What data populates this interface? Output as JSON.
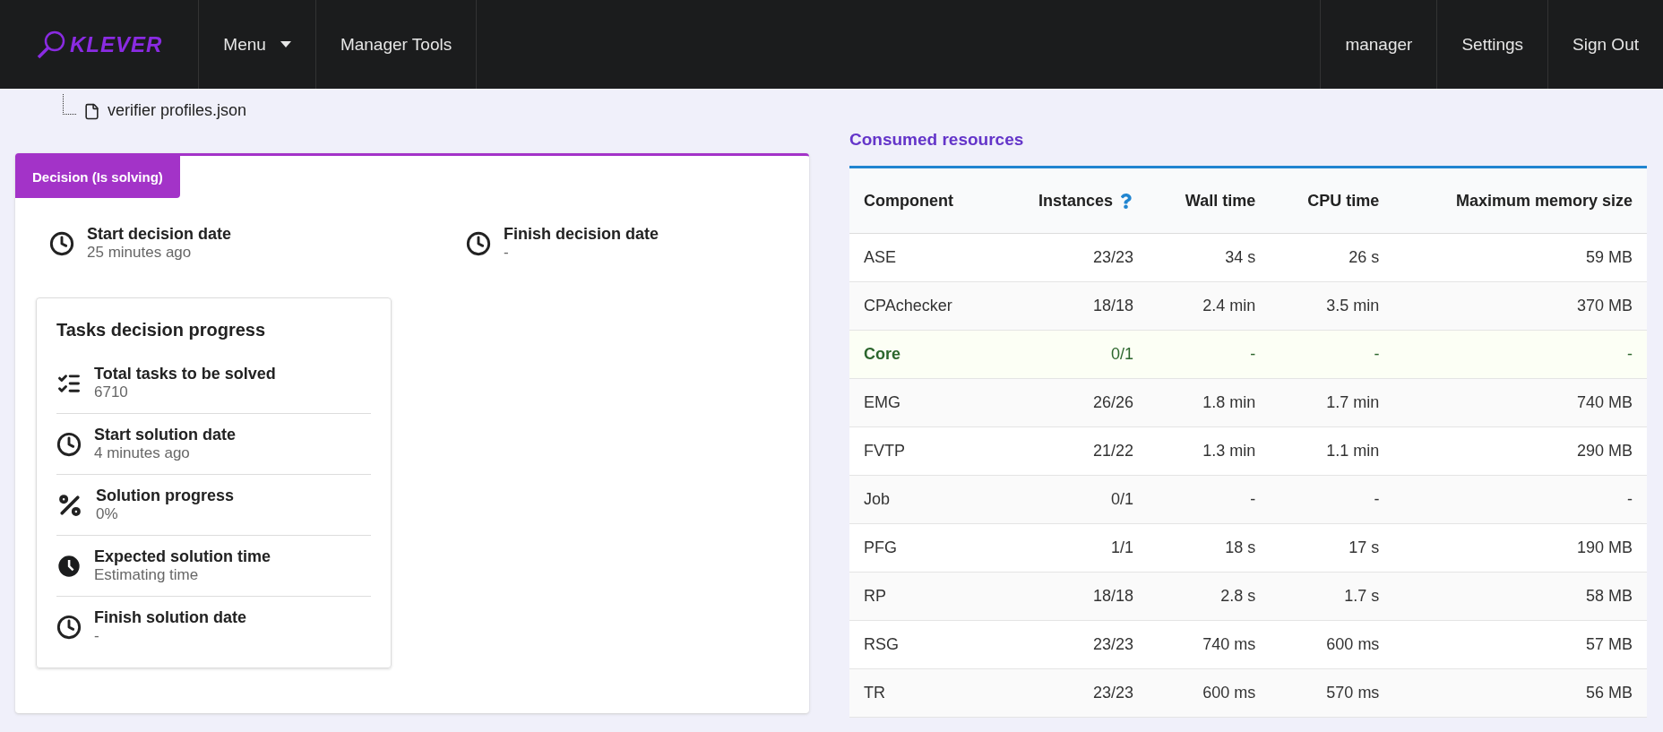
{
  "navbar": {
    "logo": "KLEVER",
    "items": [
      {
        "label": "Menu",
        "kind": "dropdown"
      },
      {
        "label": "Manager Tools",
        "kind": "link"
      }
    ],
    "right_items": [
      "manager",
      "Settings",
      "Sign Out"
    ]
  },
  "file_tree": {
    "file": "verifier profiles.json"
  },
  "decision": {
    "badge": "Decision (Is solving)",
    "dates": [
      {
        "label": "Start decision date",
        "value": "25 minutes ago"
      },
      {
        "label": "Finish decision date",
        "value": "-"
      }
    ],
    "progress": {
      "title": "Tasks decision progress",
      "items": [
        {
          "kind": "count",
          "label": "Total tasks to be solved",
          "value": "6710"
        },
        {
          "kind": "date",
          "label": "Start solution date",
          "value": "4 minutes ago"
        },
        {
          "kind": "progress",
          "label": "Solution progress",
          "value": "0%"
        },
        {
          "kind": "estimate",
          "label": "Expected solution time",
          "value": "Estimating time"
        },
        {
          "kind": "date",
          "label": "Finish solution date",
          "value": "-"
        }
      ]
    }
  },
  "resources": {
    "title": "Consumed resources",
    "columns": [
      "Component",
      "Instances",
      "Wall time",
      "CPU time",
      "Maximum memory size"
    ],
    "rows": [
      {
        "cells": [
          "ASE",
          "23/23",
          "34 s",
          "26 s",
          "59 MB"
        ],
        "highlighted": false
      },
      {
        "cells": [
          "CPAchecker",
          "18/18",
          "2.4 min",
          "3.5 min",
          "370 MB"
        ],
        "highlighted": false
      },
      {
        "cells": [
          "Core",
          "0/1",
          "-",
          "-",
          "-"
        ],
        "highlighted": true
      },
      {
        "cells": [
          "EMG",
          "26/26",
          "1.8 min",
          "1.7 min",
          "740 MB"
        ],
        "highlighted": false
      },
      {
        "cells": [
          "FVTP",
          "21/22",
          "1.3 min",
          "1.1 min",
          "290 MB"
        ],
        "highlighted": false
      },
      {
        "cells": [
          "Job",
          "0/1",
          "-",
          "-",
          "-"
        ],
        "highlighted": false
      },
      {
        "cells": [
          "PFG",
          "1/1",
          "18 s",
          "17 s",
          "190 MB"
        ],
        "highlighted": false
      },
      {
        "cells": [
          "RP",
          "18/18",
          "2.8 s",
          "1.7 s",
          "58 MB"
        ],
        "highlighted": false
      },
      {
        "cells": [
          "RSG",
          "23/23",
          "740 ms",
          "600 ms",
          "57 MB"
        ],
        "highlighted": false
      },
      {
        "cells": [
          "TR",
          "23/23",
          "600 ms",
          "570 ms",
          "56 MB"
        ],
        "highlighted": false
      }
    ]
  }
}
